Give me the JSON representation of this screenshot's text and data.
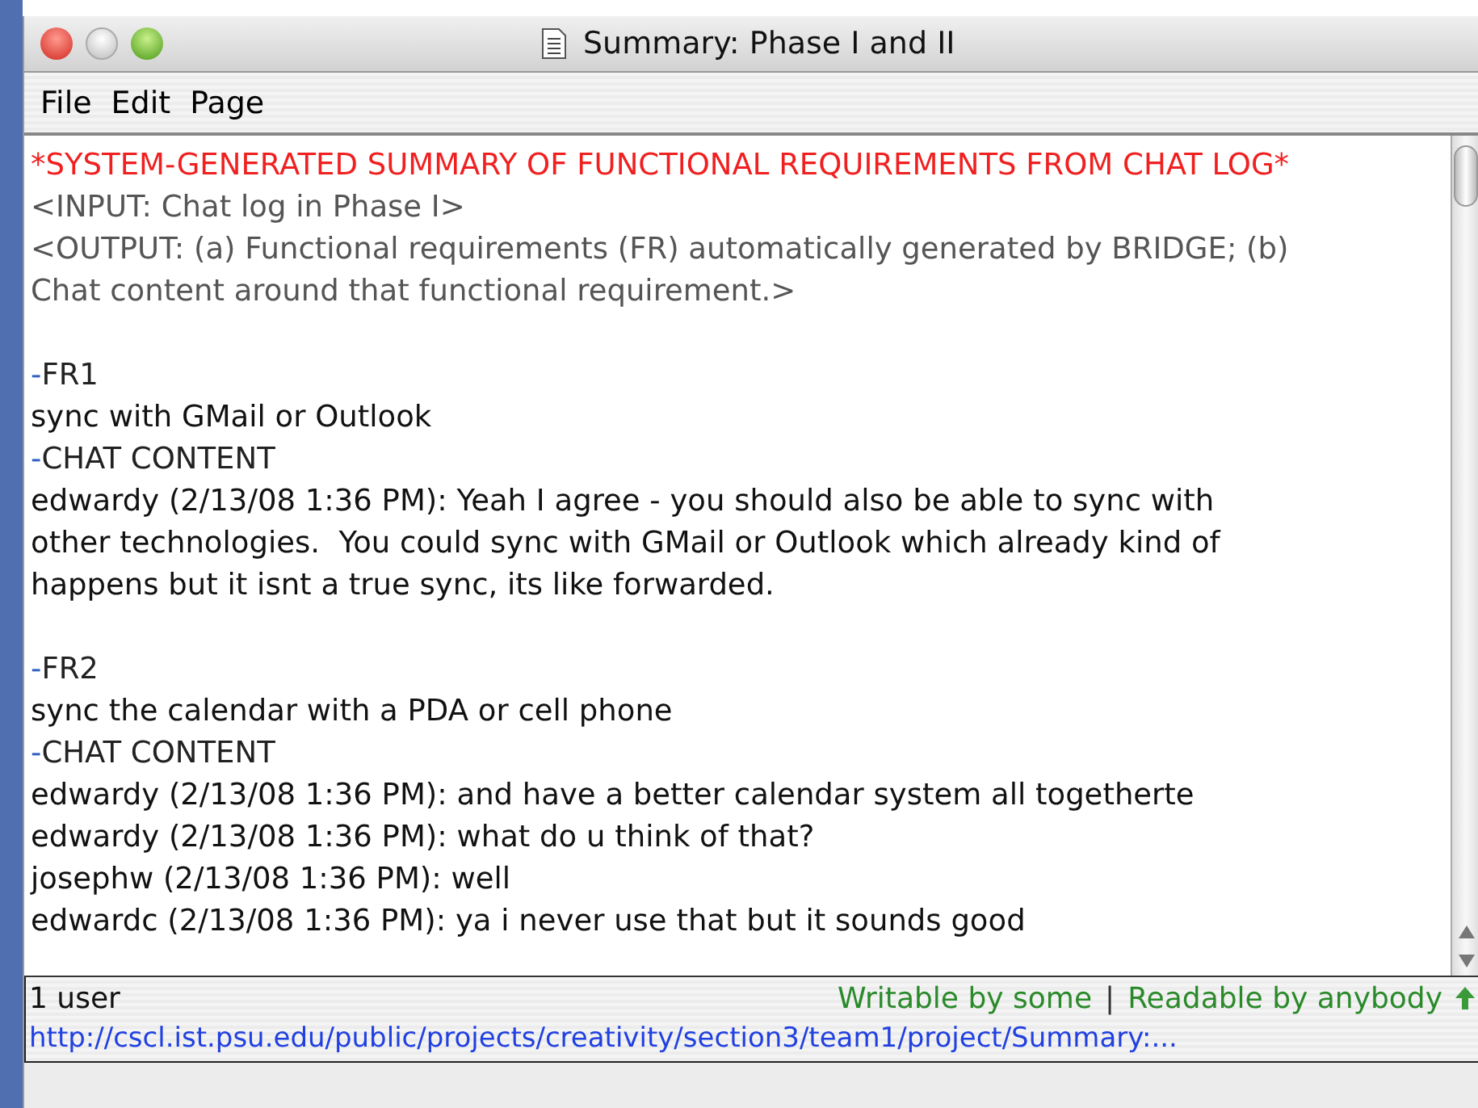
{
  "window": {
    "title": "Summary: Phase I and II"
  },
  "menu": [
    "File",
    "Edit",
    "Page"
  ],
  "lines": [
    {
      "kind": "header",
      "text": "*SYSTEM-GENERATED SUMMARY OF FUNCTIONAL REQUIREMENTS FROM CHAT LOG*"
    },
    {
      "kind": "meta",
      "text": "<INPUT: Chat log in Phase I>"
    },
    {
      "kind": "meta",
      "text": "<OUTPUT: (a) Functional requirements (FR) automatically generated by BRIDGE; (b)"
    },
    {
      "kind": "meta",
      "text": "Chat content around that functional requirement.>"
    },
    {
      "kind": "gap"
    },
    {
      "kind": "marker",
      "dash": "-",
      "text": "FR1"
    },
    {
      "kind": "body",
      "text": "sync with GMail or Outlook"
    },
    {
      "kind": "marker",
      "dash": "-",
      "text": "CHAT CONTENT"
    },
    {
      "kind": "body",
      "text": "edwardy (2/13/08 1:36 PM): Yeah I agree - you should also be able to sync with"
    },
    {
      "kind": "body",
      "text": "other technologies.  You could sync with GMail or Outlook which already kind of"
    },
    {
      "kind": "body",
      "text": "happens but it isnt a true sync, its like forwarded."
    },
    {
      "kind": "gap"
    },
    {
      "kind": "marker",
      "dash": "-",
      "text": "FR2"
    },
    {
      "kind": "body",
      "text": "sync the calendar with a PDA or cell phone"
    },
    {
      "kind": "marker",
      "dash": "-",
      "text": "CHAT CONTENT"
    },
    {
      "kind": "body",
      "text": "edwardy (2/13/08 1:36 PM): and have a better calendar system all togetherte"
    },
    {
      "kind": "body",
      "text": "edwardy (2/13/08 1:36 PM): what do u think of that?"
    },
    {
      "kind": "body",
      "text": "josephw (2/13/08 1:36 PM): well"
    },
    {
      "kind": "body",
      "text": "edwardc (2/13/08 1:36 PM): ya i never use that but it sounds good"
    }
  ],
  "status": {
    "users": "1 user",
    "write": "Writable by some",
    "separator": "|",
    "read": "Readable by anybody"
  },
  "url": "http://cscl.ist.psu.edu/public/projects/creativity/section3/team1/project/Summary:..."
}
